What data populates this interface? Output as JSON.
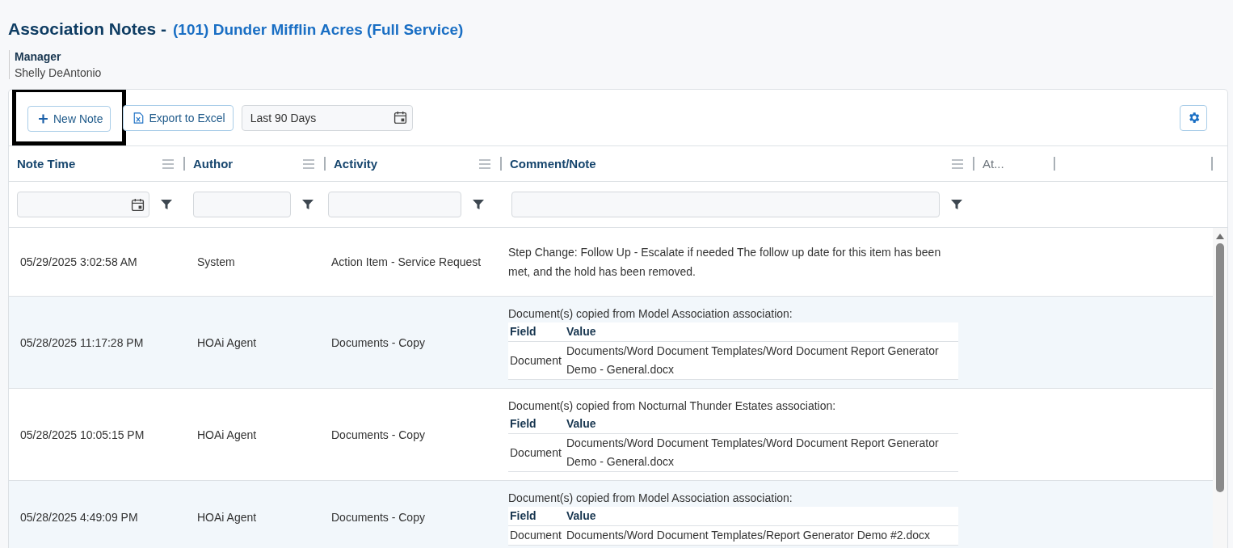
{
  "page": {
    "title": "Association Notes -",
    "association": "(101) Dunder Mifflin Acres (Full Service)"
  },
  "manager": {
    "label": "Manager",
    "name": "Shelly DeAntonio"
  },
  "toolbar": {
    "new_note": {
      "label": "New Note",
      "highlighted": true
    },
    "export": {
      "label": "Export to Excel"
    },
    "date_range": {
      "value": "Last 90 Days"
    }
  },
  "table": {
    "columns": [
      {
        "label": "Note Time",
        "kind": "date"
      },
      {
        "label": "Author",
        "kind": "text"
      },
      {
        "label": "Activity",
        "kind": "text"
      },
      {
        "label": "Comment/Note",
        "kind": "text"
      },
      {
        "label": "At...",
        "kind": "plain"
      }
    ],
    "rows": [
      {
        "time": "05/29/2025 3:02:58 AM",
        "author": "System",
        "activity": "Action Item - Service Request",
        "comment": {
          "kind": "text",
          "text": "Step Change: Follow Up - Escalate if needed The follow up date for this item has been met, and the hold has been removed."
        }
      },
      {
        "time": "05/28/2025 11:17:28 PM",
        "author": "HOAi Agent",
        "activity": "Documents - Copy",
        "comment": {
          "kind": "doc_table",
          "intro": "Document(s) copied from Model Association association:",
          "headers": [
            "Field",
            "Value"
          ],
          "rows": [
            [
              "Document",
              "Documents/Word Document Templates/Word Document Report Generator Demo - General.docx"
            ]
          ]
        }
      },
      {
        "time": "05/28/2025 10:05:15 PM",
        "author": "HOAi Agent",
        "activity": "Documents - Copy",
        "comment": {
          "kind": "doc_table",
          "intro": "Document(s) copied from Nocturnal Thunder Estates association:",
          "headers": [
            "Field",
            "Value"
          ],
          "rows": [
            [
              "Document",
              "Documents/Word Document Templates/Word Document Report Generator Demo - General.docx"
            ]
          ]
        }
      },
      {
        "time": "05/28/2025 4:49:09 PM",
        "author": "HOAi Agent",
        "activity": "Documents - Copy",
        "comment": {
          "kind": "doc_table",
          "intro": "Document(s) copied from Model Association association:",
          "headers": [
            "Field",
            "Value"
          ],
          "rows": [
            [
              "Document",
              "Documents/Word Document Templates/Report Generator Demo #2.docx"
            ]
          ]
        }
      }
    ]
  }
}
